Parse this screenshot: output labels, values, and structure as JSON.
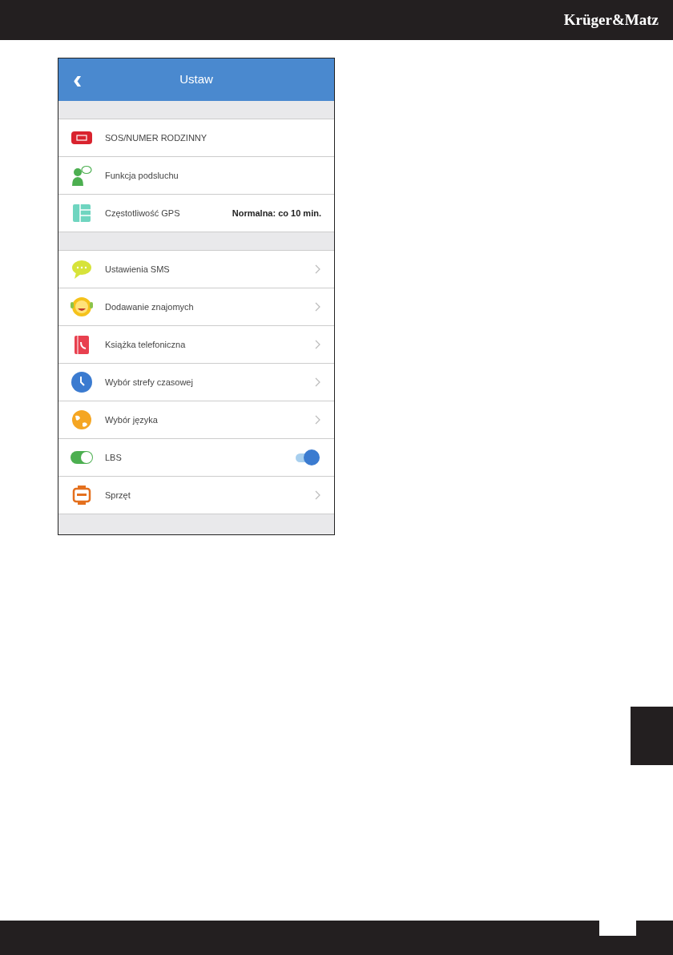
{
  "brand": "Krüger&Matz",
  "app": {
    "title": "Ustaw",
    "back": "‹",
    "sections": [
      {
        "items": [
          {
            "kind": "plain",
            "label": "SOS/NUMER RODZINNY"
          },
          {
            "kind": "plain",
            "label": "Funkcja podsluchu"
          },
          {
            "kind": "value",
            "label": "Częstotliwość GPS",
            "value": "Normalna: co 10 min."
          }
        ]
      },
      {
        "items": [
          {
            "kind": "link",
            "label": "Ustawienia SMS"
          },
          {
            "kind": "link",
            "label": "Dodawanie znajomych"
          },
          {
            "kind": "link",
            "label": "Książka telefoniczna"
          },
          {
            "kind": "link",
            "label": "Wybór strefy czasowej"
          },
          {
            "kind": "link",
            "label": "Wybór języka"
          },
          {
            "kind": "toggle",
            "label": "LBS",
            "on": true
          },
          {
            "kind": "link",
            "label": "Sprzęt"
          }
        ]
      }
    ]
  }
}
